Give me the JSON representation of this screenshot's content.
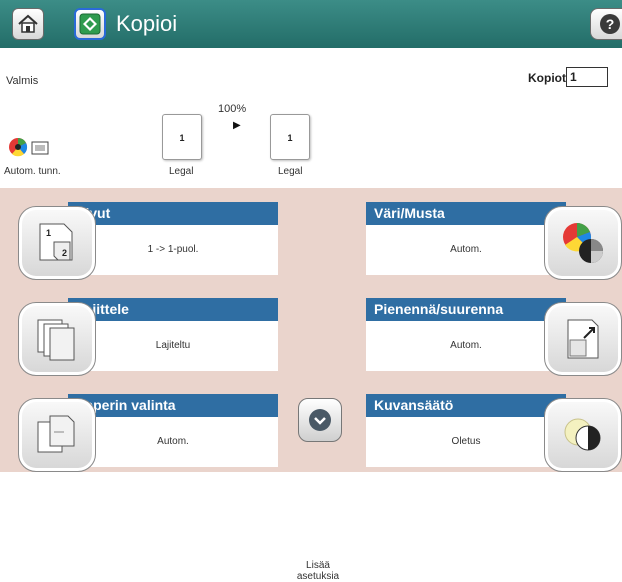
{
  "header": {
    "title": "Kopioi",
    "home_icon": "home-icon",
    "copy_icon": "copy-start-icon",
    "help_icon": "help-icon"
  },
  "status": {
    "text": "Valmis",
    "copies_label": "Kopiot:",
    "copies_value": "1"
  },
  "preview": {
    "zoom": "100%",
    "source_page_number": "1",
    "output_page_number": "1",
    "source_label": "Legal",
    "output_label": "Legal",
    "color_mode_label": "Autom. tunn."
  },
  "tiles": {
    "sides": {
      "title": "Sivut",
      "value": "1 -> 1-puol."
    },
    "collate": {
      "title": "Lajittele",
      "value": "Lajiteltu"
    },
    "paper": {
      "title": "Paperin valinta",
      "value": "Autom."
    },
    "color": {
      "title": "Väri/Musta",
      "value": "Autom."
    },
    "reduce": {
      "title": "Pienennä/suurenna",
      "value": "Autom."
    },
    "image": {
      "title": "Kuvansäätö",
      "value": "Oletus"
    }
  },
  "more": {
    "label_line1": "Lisää",
    "label_line2": "asetuksia"
  },
  "colors": {
    "header": "#2f7d78",
    "tile_title": "#2f6ea3",
    "panel_bg": "#ead4cc"
  }
}
